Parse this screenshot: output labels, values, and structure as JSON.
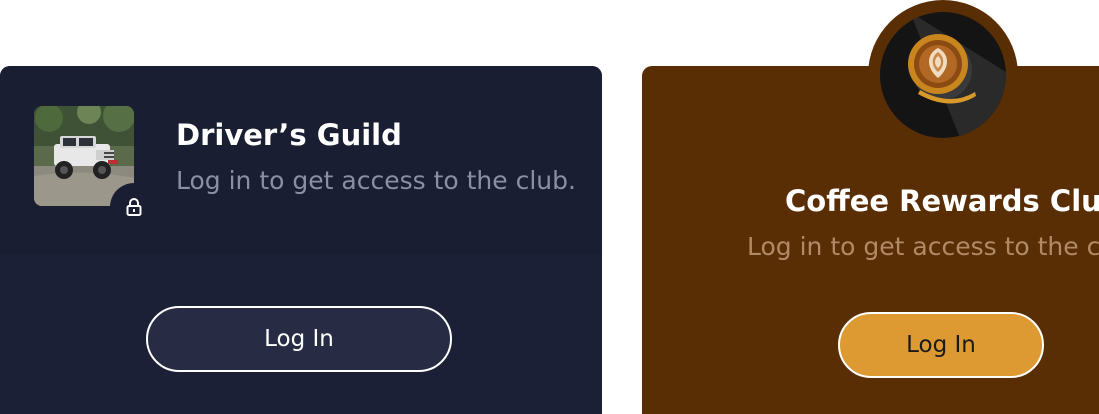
{
  "cards": [
    {
      "title": "Driver’s Guild",
      "subtitle": "Log in to get access to the club.",
      "button_label": "Log In",
      "image": "jeep-photo",
      "badge_icon": "lock-icon",
      "background": "#1b2037",
      "button_color": "#272c44"
    },
    {
      "title": "Coffee Rewards Club",
      "subtitle": "Log in to get access to the club.",
      "button_label": "Log In",
      "image": "latte-art-photo",
      "background": "#5a2e05",
      "button_color": "#dd9a32"
    }
  ]
}
